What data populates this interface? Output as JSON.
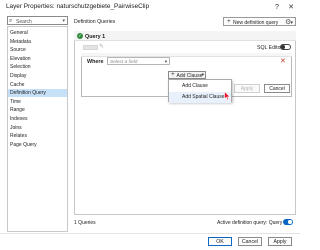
{
  "window": {
    "title": "Layer Properties: naturschutzgebiete_PairwiseClip",
    "help_glyph": "?",
    "close_glyph": "✕"
  },
  "sidebar": {
    "search_placeholder": "Search",
    "items": [
      {
        "label": "General"
      },
      {
        "label": "Metadata"
      },
      {
        "label": "Source"
      },
      {
        "label": "Elevation"
      },
      {
        "label": "Selection"
      },
      {
        "label": "Display"
      },
      {
        "label": "Cache"
      },
      {
        "label": "Definition Query",
        "selected": true
      },
      {
        "label": "Time"
      },
      {
        "label": "Range"
      },
      {
        "label": "Indexes"
      },
      {
        "label": "Joins"
      },
      {
        "label": "Relates"
      },
      {
        "label": "Page Query"
      }
    ]
  },
  "main": {
    "heading": "Definition Queries",
    "new_query_button": "New definition query",
    "query": {
      "title": "Query 1",
      "status_icon": "check-circle-icon",
      "sql_editor_label": "SQL Editor",
      "sql_editor_on": false,
      "clause": {
        "where_label": "Where",
        "field_placeholder": "Select a field"
      },
      "add_clause_button": "Add Clause",
      "apply_label": "Apply",
      "cancel_label": "Cancel"
    },
    "add_clause_menu": [
      {
        "label": "Add Clause"
      },
      {
        "label": "Add Spatial Clause",
        "hover": true
      }
    ],
    "queries_count": "1 Queries",
    "active_query_label": "Active definition query: Query 1",
    "active_query_on": true
  },
  "footer": {
    "ok_label": "OK",
    "cancel_label": "Cancel",
    "apply_label": "Apply"
  },
  "colors": {
    "selection_blue": "#c5e0f7",
    "accent_blue": "#0b66c2",
    "check_green": "#2e8b3a",
    "close_red": "#c0392b"
  }
}
